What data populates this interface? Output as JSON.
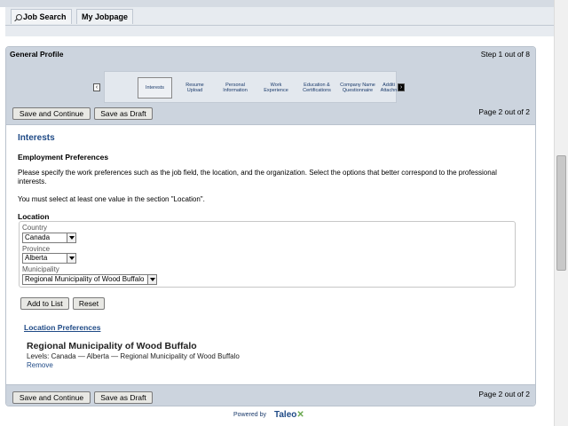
{
  "tabs": {
    "job_search": "Job Search",
    "my_jobpage": "My Jobpage"
  },
  "panel": {
    "title": "General Profile",
    "step": "Step 1 out of 8",
    "page": "Page 2 out of 2"
  },
  "wizard": {
    "steps": [
      "Interests",
      "Resume Upload",
      "Personal Information",
      "Work Experience",
      "Education & Certifications",
      "Company Name Questionnaire",
      "Additi Attachn"
    ]
  },
  "buttons": {
    "save_continue": "Save and Continue",
    "save_draft": "Save as Draft",
    "add_to_list": "Add to List",
    "reset": "Reset"
  },
  "content": {
    "heading": "Interests",
    "subheading": "Employment Preferences",
    "description": "Please specify the work preferences such as the job field, the location, and the organization. Select the options that better correspond to the professional interests.",
    "must_select": "You must select at least one value in the section \"Location\".",
    "location_heading": "Location",
    "country_label": "Country",
    "country_value": "Canada",
    "province_label": "Province",
    "province_value": "Alberta",
    "municipality_label": "Municipality",
    "municipality_value": "Regional Municipality of Wood Buffalo",
    "location_prefs_link": "Location Preferences",
    "result_title": "Regional Municipality of Wood Buffalo",
    "result_levels": "Levels:  Canada — Alberta — Regional Municipality of Wood Buffalo",
    "remove": "Remove"
  },
  "footer": {
    "powered_by": "Powered by",
    "brand": "Taleo",
    "brand_mark": "✕"
  }
}
